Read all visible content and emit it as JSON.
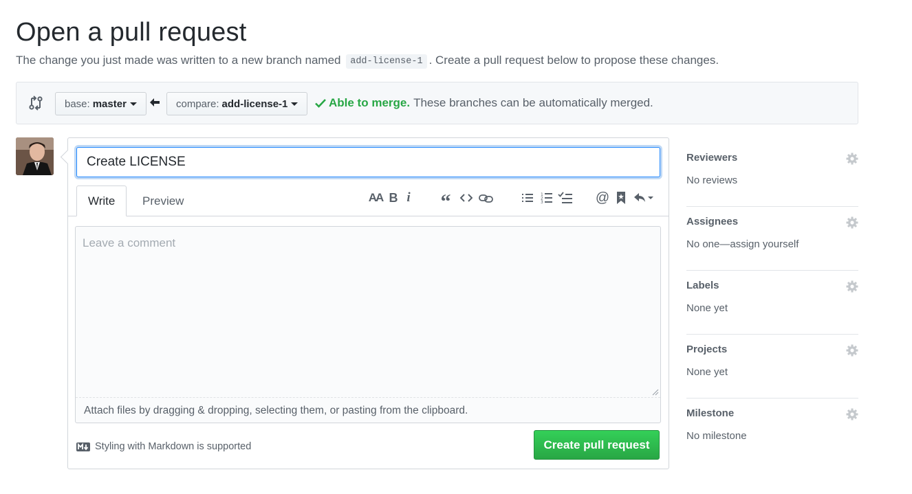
{
  "page": {
    "title": "Open a pull request",
    "subtitle_before": "The change you just made was written to a new branch named",
    "branch_code": "add-license-1",
    "subtitle_after": ". Create a pull request below to propose these changes."
  },
  "compare": {
    "icon": "git-compare-icon",
    "base_prefix": "base:",
    "base_branch": "master",
    "arrow_icon": "arrow-left-icon",
    "compare_prefix": "compare:",
    "compare_branch": "add-license-1",
    "merge_check_icon": "check-icon",
    "merge_status": "Able to merge.",
    "merge_detail": "These branches can be automatically merged."
  },
  "composer": {
    "title_value": "Create LICENSE",
    "tabs": [
      {
        "label": "Write",
        "active": true
      },
      {
        "label": "Preview",
        "active": false
      }
    ],
    "toolbar_icons": [
      "header-icon",
      "bold-icon",
      "italic-icon",
      "quote-icon",
      "code-icon",
      "link-icon",
      "unordered-list-icon",
      "ordered-list-icon",
      "task-list-icon",
      "mention-icon",
      "bookmark-icon",
      "reply-icon"
    ],
    "comment_placeholder": "Leave a comment",
    "attach_text": "Attach files by dragging & dropping, selecting them, or pasting from the clipboard.",
    "markdown_note": "Styling with Markdown is supported",
    "submit_label": "Create pull request"
  },
  "sidebar": {
    "sections": [
      {
        "heading": "Reviewers",
        "value": "No reviews"
      },
      {
        "heading": "Assignees",
        "value": "No one—assign yourself"
      },
      {
        "heading": "Labels",
        "value": "None yet"
      },
      {
        "heading": "Projects",
        "value": "None yet"
      },
      {
        "heading": "Milestone",
        "value": "No milestone"
      }
    ]
  },
  "colors": {
    "accent_green": "#28a745",
    "focus_blue": "#2188ff",
    "text_muted": "#586069"
  }
}
